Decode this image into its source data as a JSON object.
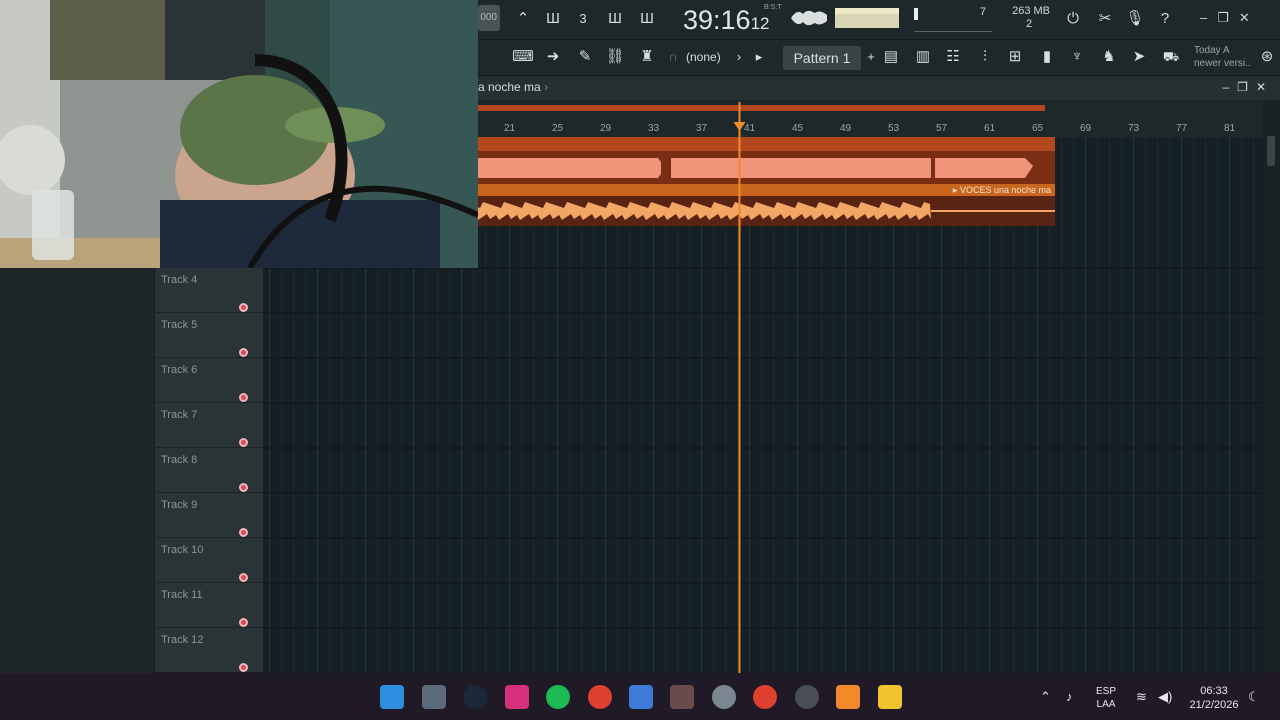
{
  "toolbar": {
    "song_position": "000",
    "time_main": "39:16",
    "time_small": "12",
    "time_unit": "B:S:T",
    "cpu_value": "7",
    "memory": "263 MB",
    "polyphony": "2",
    "snap_value": "(none)",
    "pattern_name": "Pattern 1",
    "news_line1": "Today  A",
    "news_line2": "newer versi.."
  },
  "playlist": {
    "title": "a noche ma",
    "ruler": [
      "21",
      "25",
      "29",
      "33",
      "37",
      "41",
      "45",
      "49",
      "53",
      "57",
      "61",
      "65",
      "69",
      "73",
      "77",
      "81"
    ],
    "clip_label": "VOCES una noche ma",
    "tracks": [
      "Track 4",
      "Track 5",
      "Track 6",
      "Track 7",
      "Track 8",
      "Track 9",
      "Track 10",
      "Track 11",
      "Track 12"
    ]
  },
  "taskbar": {
    "language_line1": "ESP",
    "language_line2": "LAA",
    "time": "06:33",
    "date": "21/2/2026"
  },
  "colors": {
    "accent_orange": "#f08a2a",
    "clip_salmon": "#f1957a",
    "clip_dark": "#b3481e",
    "grid_bg": "#152024",
    "led_red": "#d94a55"
  }
}
